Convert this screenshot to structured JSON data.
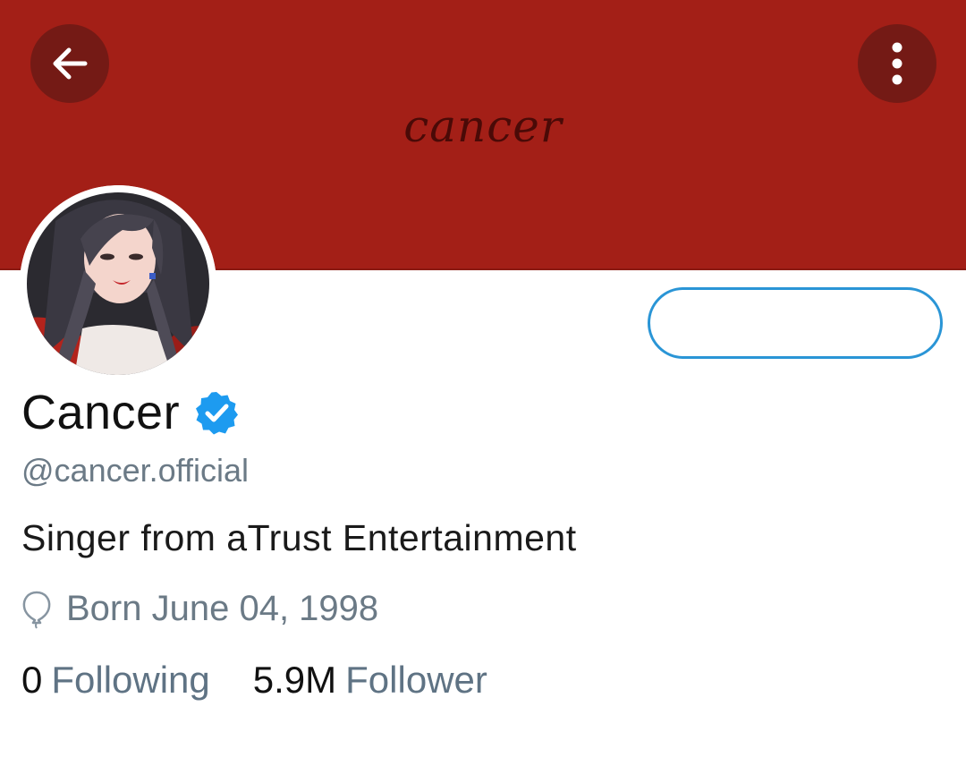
{
  "header": {
    "banner_title": "cancer",
    "banner_color": "#a31f17",
    "back_icon": "arrow-left-icon",
    "more_icon": "more-vertical-icon"
  },
  "profile": {
    "display_name": "Cancer",
    "verified_icon": "verified-badge-icon",
    "handle": "@cancer.official",
    "bio": "Singer from aTrust Entertainment",
    "birthday_icon": "balloon-icon",
    "birthday": "Born June 04, 1998",
    "follow_button_label": ""
  },
  "stats": {
    "following_count": "0",
    "following_label": "Following",
    "followers_count": "5.9M",
    "followers_label": "Follower"
  },
  "colors": {
    "accent": "#2a95d6",
    "muted_text": "#6b7a86"
  }
}
